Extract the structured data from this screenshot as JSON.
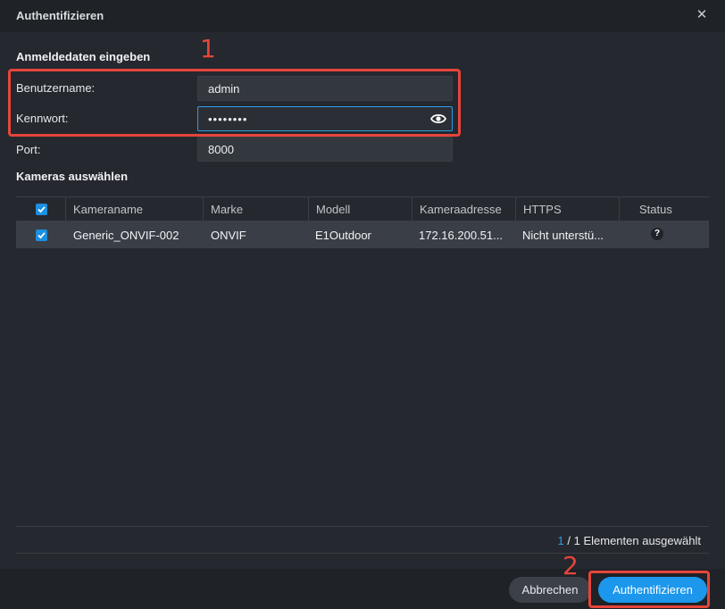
{
  "dialog": {
    "title": "Authentifizieren",
    "close_icon": "close-icon"
  },
  "credentials": {
    "section_title": "Anmeldedaten eingeben",
    "username_label": "Benutzername:",
    "username_value": "admin",
    "password_label": "Kennwort:",
    "password_value": "••••••••",
    "port_label": "Port:",
    "port_value": "8000"
  },
  "cameras": {
    "section_title": "Kameras auswählen",
    "columns": [
      "Kameraname",
      "Marke",
      "Modell",
      "Kameraadresse",
      "HTTPS",
      "Status"
    ],
    "rows": [
      {
        "checked": true,
        "name": "Generic_ONVIF-002",
        "brand": "ONVIF",
        "model": "E1Outdoor",
        "address": "172.16.200.51...",
        "https": "Nicht unterstü...",
        "status": "?"
      }
    ]
  },
  "selection": {
    "page": "1",
    "text": "/ 1 Elementen ausgewählt"
  },
  "buttons": {
    "cancel": "Abbrechen",
    "authenticate": "Authentifizieren"
  },
  "annotations": {
    "step1": "1",
    "step2": "2"
  },
  "colors": {
    "accent": "#1c97ec",
    "annotation": "#e5453c",
    "background": "#25282e"
  }
}
